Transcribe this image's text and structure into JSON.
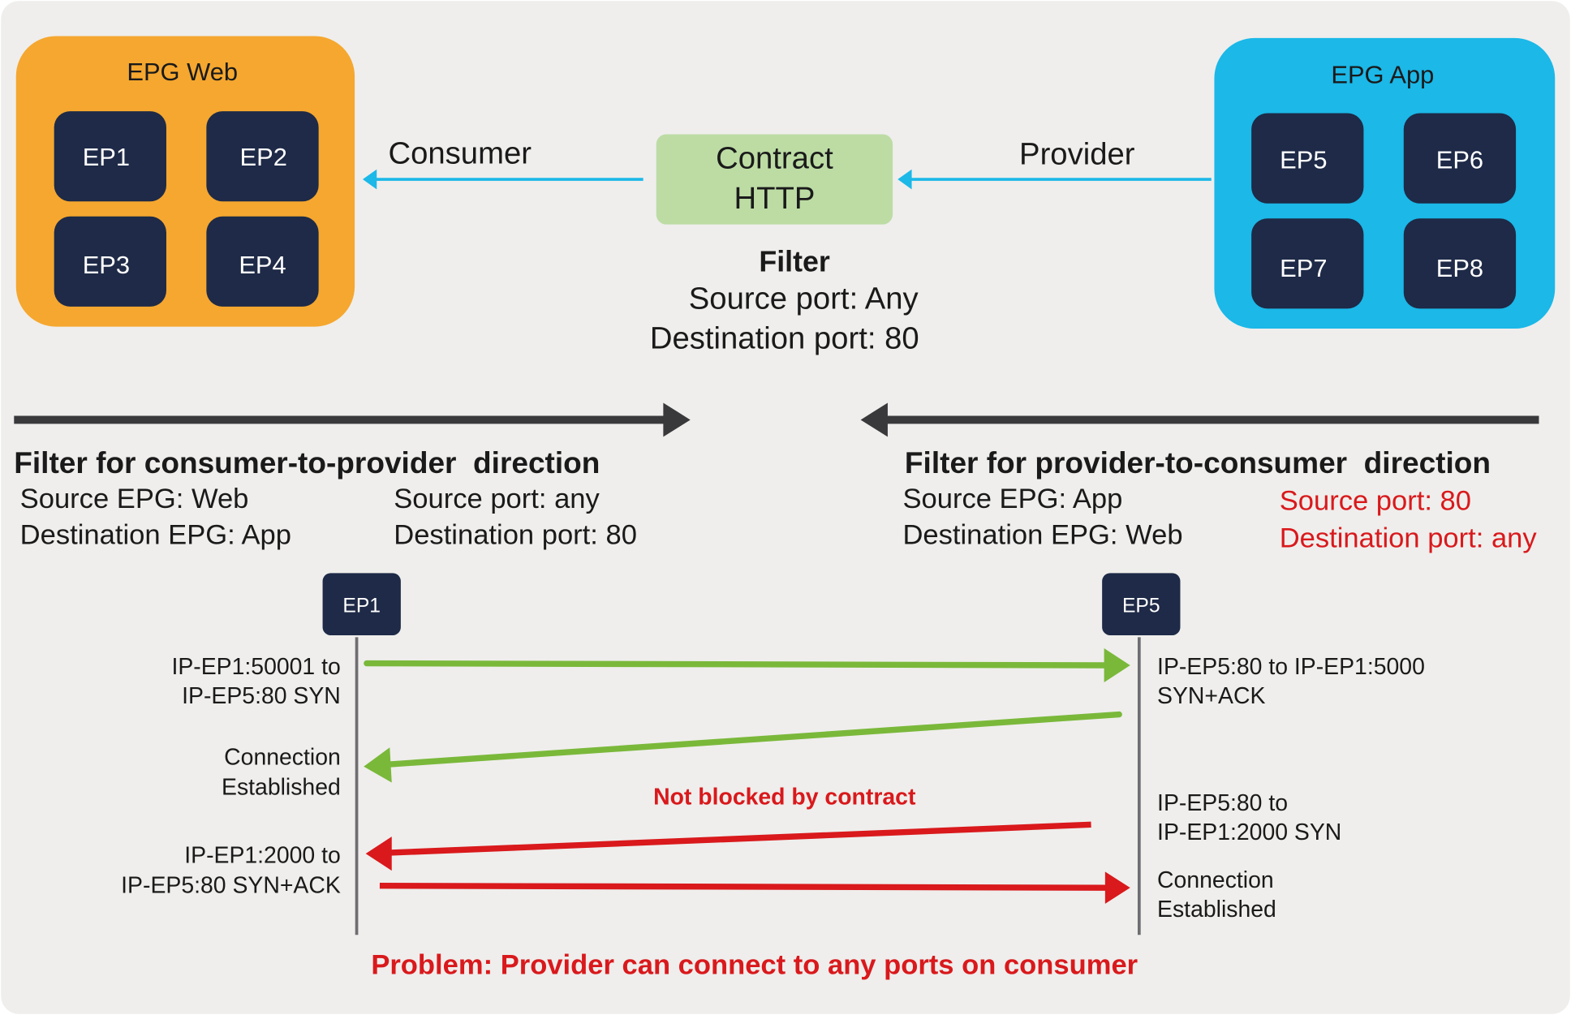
{
  "colors": {
    "background": "#efeeec",
    "epg_web": "#f5a72f",
    "epg_app": "#1bb8e8",
    "endpoint": "#1e2a47",
    "contract": "#bcdca4",
    "link_arrow": "#1bb8e8",
    "direction_arrow": "#39393b",
    "ok_flow": "#7ab83a",
    "bad_flow": "#d9191c",
    "lifeline": "#6e6e72",
    "highlight_text": "#d9191c"
  },
  "epg_web": {
    "title": "EPG Web",
    "endpoints": [
      "EP1",
      "EP2",
      "EP3",
      "EP4"
    ]
  },
  "epg_app": {
    "title": "EPG App",
    "endpoints": [
      "EP5",
      "EP6",
      "EP7",
      "EP8"
    ]
  },
  "relations": {
    "consumer_label": "Consumer",
    "provider_label": "Provider"
  },
  "contract": {
    "line1": "Contract",
    "line2": "HTTP"
  },
  "filter": {
    "title": "Filter",
    "source_port": "Source port: Any",
    "destination_port": "Destination port: 80"
  },
  "consumer_to_provider": {
    "title": "Filter for consumer-to-provider  direction",
    "source_epg": "Source EPG: Web",
    "destination_epg": "Destination EPG: App",
    "source_port": "Source port: any",
    "destination_port": "Destination port: 80"
  },
  "provider_to_consumer": {
    "title": "Filter for provider-to-consumer  direction",
    "source_epg": "Source EPG: App",
    "destination_epg": "Destination EPG: Web",
    "source_port": "Source port: 80",
    "destination_port": "Destination port: any"
  },
  "sequence": {
    "left_endpoint": "EP1",
    "right_endpoint": "EP5",
    "messages": [
      {
        "direction": "EP1->EP5",
        "status": "allowed",
        "left_label": [
          "IP-EP1:50001 to",
          "IP-EP5:80 SYN"
        ],
        "right_label": [
          "IP-EP5:80 to IP-EP1:5000",
          "SYN+ACK"
        ]
      },
      {
        "direction": "EP5->EP1",
        "status": "allowed",
        "left_label": [
          "Connection",
          "Established"
        ]
      },
      {
        "direction": "EP5->EP1",
        "status": "not-blocked",
        "right_label": [
          "IP-EP5:80 to",
          "IP-EP1:2000 SYN"
        ],
        "annotation": "Not blocked by contract"
      },
      {
        "direction": "EP1->EP5",
        "status": "not-blocked",
        "left_label": [
          "IP-EP1:2000 to",
          "IP-EP5:80 SYN+ACK"
        ],
        "right_label": [
          "Connection",
          "Established"
        ]
      }
    ],
    "problem": "Problem: Provider can connect to any ports on consumer"
  }
}
